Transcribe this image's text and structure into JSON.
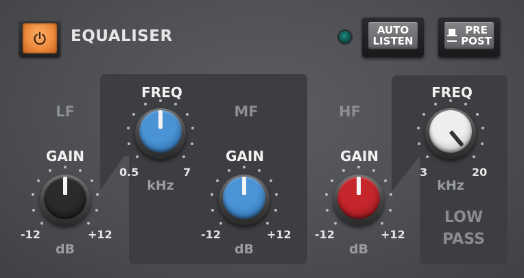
{
  "header": {
    "title": "EQUALISER",
    "power_icon": "power-icon",
    "auto_listen": [
      "AUTO",
      "LISTEN"
    ],
    "pre_post": [
      "PRE",
      "POST"
    ],
    "colors": {
      "power_on": "#ee8a3b",
      "led": "#1e8b84"
    }
  },
  "bands": {
    "lf": {
      "name": "LF",
      "gain": {
        "label": "GAIN",
        "min": "-12",
        "max": "+12",
        "unit": "dB",
        "knob_color": "#2b2b2b"
      }
    },
    "mf": {
      "name": "MF",
      "freq": {
        "label": "FREQ",
        "min": "0.5",
        "max": "7",
        "unit": "kHz",
        "knob_color": "#3f86c7"
      },
      "gain": {
        "label": "GAIN",
        "min": "-12",
        "max": "+12",
        "unit": "dB",
        "knob_color": "#3f86c7"
      }
    },
    "hf": {
      "name": "HF",
      "gain": {
        "label": "GAIN",
        "min": "-12",
        "max": "+12",
        "unit": "dB",
        "knob_color": "#b8272c"
      }
    },
    "low_pass": {
      "freq": {
        "label": "FREQ",
        "min": "3",
        "max": "20",
        "unit": "kHz",
        "knob_color": "#e4e4e4"
      },
      "name_line1": "LOW",
      "name_line2": "PASS"
    }
  }
}
